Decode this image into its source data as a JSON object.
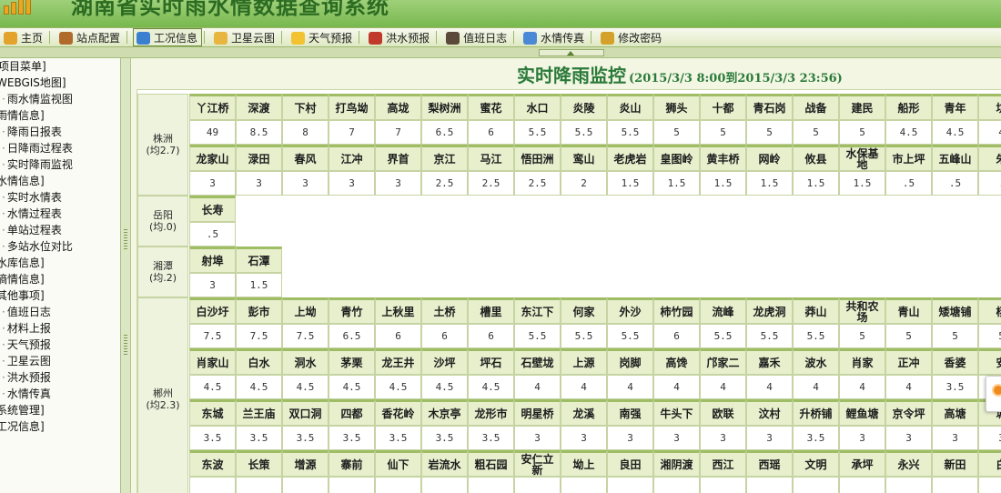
{
  "app": {
    "title": "湖南省实时雨水情数据查询系统"
  },
  "nav": {
    "active": "工况信息",
    "items": [
      {
        "label": "主页",
        "icon": "home-icon",
        "color": "#e3a22b"
      },
      {
        "label": "站点配置",
        "icon": "pen-icon",
        "color": "#b06a2a"
      },
      {
        "label": "工况信息",
        "icon": "tools-icon",
        "color": "#3b7fd0"
      },
      {
        "label": "卫星云图",
        "icon": "folder-icon",
        "color": "#e8b640"
      },
      {
        "label": "天气预报",
        "icon": "sun-cloud-icon",
        "color": "#f2c230"
      },
      {
        "label": "洪水预报",
        "icon": "car-icon",
        "color": "#c0392b"
      },
      {
        "label": "值班日志",
        "icon": "book-icon",
        "color": "#5b4a3a"
      },
      {
        "label": "水情传真",
        "icon": "chart-icon",
        "color": "#4b88d6"
      },
      {
        "label": "修改密码",
        "icon": "key-icon",
        "color": "#d4a12a"
      }
    ]
  },
  "sidebar": {
    "lines": [
      {
        "label": "项目菜单]",
        "kind": "head"
      },
      {
        "label": "WEBGIS地图]",
        "kind": "top"
      },
      {
        "label": "雨水情监视图",
        "kind": "sub"
      },
      {
        "label": "雨情信息]",
        "kind": "top"
      },
      {
        "label": "降雨日报表",
        "kind": "sub"
      },
      {
        "label": "日降雨过程表",
        "kind": "sub"
      },
      {
        "label": "实时降雨监视",
        "kind": "sub"
      },
      {
        "label": "水情信息]",
        "kind": "top"
      },
      {
        "label": "实时水情表",
        "kind": "sub"
      },
      {
        "label": "水情过程表",
        "kind": "sub"
      },
      {
        "label": "单站过程表",
        "kind": "sub"
      },
      {
        "label": "多站水位对比",
        "kind": "sub"
      },
      {
        "label": "水库信息]",
        "kind": "top"
      },
      {
        "label": "墒情信息]",
        "kind": "top"
      },
      {
        "label": "其他事项]",
        "kind": "top"
      },
      {
        "label": "值班日志",
        "kind": "sub"
      },
      {
        "label": "材料上报",
        "kind": "sub"
      },
      {
        "label": "天气预报",
        "kind": "sub"
      },
      {
        "label": "卫星云图",
        "kind": "sub"
      },
      {
        "label": "洪水预报",
        "kind": "sub"
      },
      {
        "label": "水情传真",
        "kind": "sub"
      },
      {
        "label": "系统管理]",
        "kind": "top"
      },
      {
        "label": "工况信息]",
        "kind": "top"
      }
    ]
  },
  "monitor": {
    "title": "实时降雨监控",
    "range": "(2015/3/3 8:00到2015/3/3 23:56)",
    "regions": [
      {
        "name": "株洲",
        "avg": "(均2.7)",
        "rows": [
          {
            "names": [
              "丫江桥",
              "深渡",
              "下村",
              "打鸟坳",
              "高垅",
              "梨树洲",
              "蜜花",
              "水口",
              "炎陵",
              "炎山",
              "狮头",
              "十都",
              "青石岗",
              "战备",
              "建民",
              "船形",
              "青年",
              "坑"
            ],
            "values": [
              "49",
              "8.5",
              "8",
              "7",
              "7",
              "6.5",
              "6",
              "5.5",
              "5.5",
              "5.5",
              "5",
              "5",
              "5",
              "5",
              "5",
              "4.5",
              "4.5",
              "4"
            ]
          },
          {
            "names": [
              "龙家山",
              "渌田",
              "春风",
              "江冲",
              "界首",
              "京江",
              "马江",
              "悟田洲",
              "鸾山",
              "老虎岩",
              "皇图岭",
              "黄丰桥",
              "网岭",
              "攸县",
              "水保基地",
              "市上坪",
              "五峰山",
              "朱"
            ],
            "values": [
              "3",
              "3",
              "3",
              "3",
              "3",
              "2.5",
              "2.5",
              "2.5",
              "2",
              "1.5",
              "1.5",
              "1.5",
              "1.5",
              "1.5",
              "1.5",
              ".5",
              ".5",
              "."
            ]
          }
        ]
      },
      {
        "name": "岳阳",
        "avg": "(均.0)",
        "rows": [
          {
            "names": [
              "长寿"
            ],
            "values": [
              ".5"
            ]
          }
        ]
      },
      {
        "name": "湘潭",
        "avg": "(均.2)",
        "rows": [
          {
            "names": [
              "射埠",
              "石潭"
            ],
            "values": [
              "3",
              "1.5"
            ]
          }
        ]
      },
      {
        "name": "郴州",
        "avg": "(均2.3)",
        "rows": [
          {
            "names": [
              "白沙圩",
              "彭市",
              "上坳",
              "青竹",
              "上秋里",
              "土桥",
              "槽里",
              "东江下",
              "何家",
              "外沙",
              "柿竹园",
              "流峰",
              "龙虎洞",
              "莽山",
              "共和农场",
              "青山",
              "矮塘铺",
              "杨"
            ],
            "values": [
              "7.5",
              "7.5",
              "7.5",
              "6.5",
              "6",
              "6",
              "6",
              "5.5",
              "5.5",
              "5.5",
              "6",
              "5.5",
              "5.5",
              "5.5",
              "5",
              "5",
              "5",
              "5"
            ]
          },
          {
            "names": [
              "肖家山",
              "白水",
              "洞水",
              "茅栗",
              "龙王井",
              "沙坪",
              "坪石",
              "石壁垅",
              "上源",
              "岗脚",
              "高馋",
              "邝家二",
              "嘉禾",
              "波水",
              "肖家",
              "正冲",
              "香婆",
              "安"
            ],
            "values": [
              "4.5",
              "4.5",
              "4.5",
              "4.5",
              "4.5",
              "4.5",
              "4.5",
              "4",
              "4",
              "4",
              "4",
              "4",
              "4",
              "4",
              "4",
              "4",
              "3.5",
              "3"
            ]
          },
          {
            "names": [
              "东城",
              "兰王庙",
              "双口洞",
              "四都",
              "香花岭",
              "木京亭",
              "龙形市",
              "明星桥",
              "龙溪",
              "南强",
              "牛头下",
              "欧联",
              "汶村",
              "升桥铺",
              "鲤鱼塘",
              "京令坪",
              "高塘",
              "塘"
            ],
            "values": [
              "3.5",
              "3.5",
              "3.5",
              "3.5",
              "3.5",
              "3.5",
              "3.5",
              "3",
              "3",
              "3",
              "3",
              "3",
              "3",
              "3.5",
              "3",
              "3",
              "3",
              "3"
            ]
          },
          {
            "names": [
              "东波",
              "长策",
              "增源",
              "寨前",
              "仙下",
              "岩流水",
              "粗石园",
              "安仁立新",
              "坳上",
              "良田",
              "湘阴渡",
              "西江",
              "西瑶",
              "文明",
              "承坪",
              "永兴",
              "新田",
              "白"
            ],
            "values": [
              "",
              "",
              "",
              "",
              "",
              "",
              "",
              "",
              "",
              "",
              "",
              "",
              "",
              "",
              "",
              "",
              "",
              ""
            ]
          }
        ]
      }
    ]
  }
}
